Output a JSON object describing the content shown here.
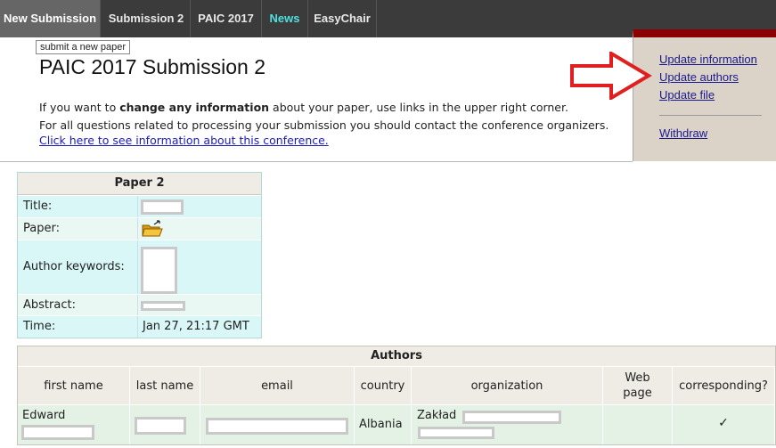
{
  "nav": {
    "tabs": [
      "New Submission",
      "Submission 2",
      "PAIC 2017",
      "News",
      "EasyChair"
    ],
    "tooltip": "submit a new paper"
  },
  "header": {
    "title": "PAIC 2017 Submission 2",
    "info1_a": "If you want to ",
    "info1_b": "change any information",
    "info1_c": " about your paper, use links in the upper right corner.",
    "info2": "For all questions related to processing your submission you should contact the conference organizers. ",
    "info2_link": "Click here to see information about this conference."
  },
  "panel": {
    "links": [
      "Update information",
      "Update authors",
      "Update file"
    ],
    "withdraw": "Withdraw"
  },
  "paper": {
    "heading": "Paper 2",
    "labels": [
      "Title:",
      "Paper:",
      "Author keywords:",
      "Abstract:",
      "Time:"
    ],
    "time": "Jan 27, 21:17 GMT",
    "file_icon": "folder-icon"
  },
  "authors": {
    "heading": "Authors",
    "columns": [
      "first name",
      "last name",
      "email",
      "country",
      "organization",
      "Web page",
      "corresponding?"
    ],
    "rows": [
      {
        "first_name": "Edward",
        "country": "Albania",
        "organization": "Zakład",
        "corresponding": "✓"
      }
    ]
  },
  "colors": {
    "accent_red": "#e02020",
    "nav_bg": "#3b3b3b",
    "news": "#4fe0e0",
    "panel_bg": "#dcd3c8"
  }
}
